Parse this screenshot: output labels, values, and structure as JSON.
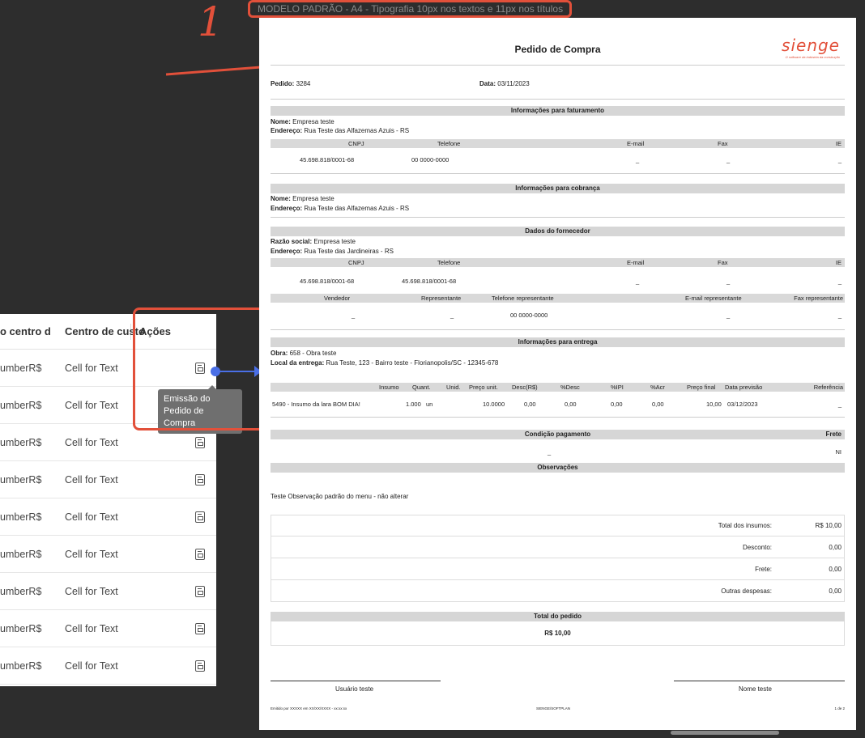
{
  "annotation": {
    "caption": "MODELO PADRÃO - A4 - Tipografia 10px nos textos e 11px nos títulos",
    "number": "1",
    "color": "#e2503a",
    "link_color": "#4a6fe6"
  },
  "table": {
    "headers": [
      "o centro de",
      "Centro de custo",
      "Ações"
    ],
    "rows": [
      {
        "col1": "umberR$",
        "col2": "Cell for Text",
        "icon": "document-report-icon"
      },
      {
        "col1": "umberR$",
        "col2": "Cell for Text",
        "icon": "document-report-icon"
      },
      {
        "col1": "umberR$",
        "col2": "Cell for Text",
        "icon": "document-report-icon"
      },
      {
        "col1": "umberR$",
        "col2": "Cell for Text",
        "icon": "document-report-icon"
      },
      {
        "col1": "umberR$",
        "col2": "Cell for Text",
        "icon": "document-report-icon"
      },
      {
        "col1": "umberR$",
        "col2": "Cell for Text",
        "icon": "document-report-icon"
      },
      {
        "col1": "umberR$",
        "col2": "Cell for Text",
        "icon": "document-report-icon"
      },
      {
        "col1": "umberR$",
        "col2": "Cell for Text",
        "icon": "document-report-icon"
      },
      {
        "col1": "umberR$",
        "col2": "Cell for Text",
        "icon": "document-report-icon"
      }
    ],
    "tooltip": "Emissão do Pedido de Compra"
  },
  "doc": {
    "title": "Pedido de Compra",
    "logo": "sienge",
    "logo_tagline": "O software da indústria da construção",
    "pedido_label": "Pedido:",
    "pedido_value": "3284",
    "data_label": "Data:",
    "data_value": "03/11/2023",
    "faturamento": {
      "title": "Informações para faturamento",
      "nome_label": "Nome:",
      "nome": "Empresa teste",
      "endereco_label": "Endereço:",
      "endereco": "Rua Teste das Alfazemas Azuis - RS",
      "cols": [
        "CNPJ",
        "Telefone",
        "E-mail",
        "Fax",
        "IE"
      ],
      "vals": [
        "45.698.818/0001-68",
        "00 0000-0000",
        "_",
        "_",
        "_"
      ]
    },
    "cobranca": {
      "title": "Informações para cobrança",
      "nome_label": "Nome:",
      "nome": "Empresa teste",
      "endereco_label": "Endereço:",
      "endereco": "Rua Teste das Alfazemas Azuis - RS"
    },
    "fornecedor": {
      "title": "Dados do fornecedor",
      "razao_label": "Razão social:",
      "razao": "Empresa teste",
      "endereco_label": "Endereço:",
      "endereco": "Rua Teste das Jardineiras - RS",
      "cols": [
        "CNPJ",
        "Telefone",
        "E-mail",
        "Fax",
        "IE"
      ],
      "vals": [
        "45.698.818/0001-68",
        "45.698.818/0001-68",
        "_",
        "_",
        "_"
      ],
      "cols2": [
        "Vendedor",
        "Representante",
        "Telefone representante",
        "E-mail representante",
        "Fax representante"
      ],
      "vals2": [
        "_",
        "_",
        "00 0000-0000",
        "_",
        "_"
      ]
    },
    "entrega": {
      "title": "Informações para entrega",
      "obra_label": "Obra:",
      "obra": "658 - Obra teste",
      "local_label": "Local da entrega:",
      "local": "Rua Teste, 123 - Bairro teste - Florianopolis/SC - 12345-678",
      "cols": [
        "Insumo",
        "Quant.",
        "Unid.",
        "Preço unit.",
        "Desc(R$)",
        "%Desc",
        "%IPI",
        "%Acr",
        "Preço final",
        "Data previsão",
        "Referência"
      ],
      "vals": [
        "5490 - Insumo da lara BOM DIA!",
        "1.000",
        "un",
        "10.0000",
        "0,00",
        "0,00",
        "0,00",
        "0,00",
        "10,00",
        "03/12/2023",
        "_"
      ]
    },
    "pagamento": {
      "title": "Condição pagamento",
      "frete_label": "Frete",
      "value": "_",
      "frete_value": "NI"
    },
    "observacoes": {
      "title": "Observações",
      "text": "Teste Observação padrão do menu - não alterar"
    },
    "totais": [
      {
        "label": "Total dos insumos:",
        "value": "R$ 10,00"
      },
      {
        "label": "Desconto:",
        "value": "0,00"
      },
      {
        "label": "Frete:",
        "value": "0,00"
      },
      {
        "label": "Outras despesas:",
        "value": "0,00"
      }
    ],
    "total_pedido_label": "Total do pedido",
    "total_pedido_value": "R$ 10,00",
    "sign_left": "Usuário teste",
    "sign_right": "Nome teste",
    "footer_left": "Emitido por XXXXX em XX/XX/XXXX - xx:xx:xx",
    "footer_center": "SIENGE/SOFTPLAN",
    "footer_right": "1 de 2"
  }
}
